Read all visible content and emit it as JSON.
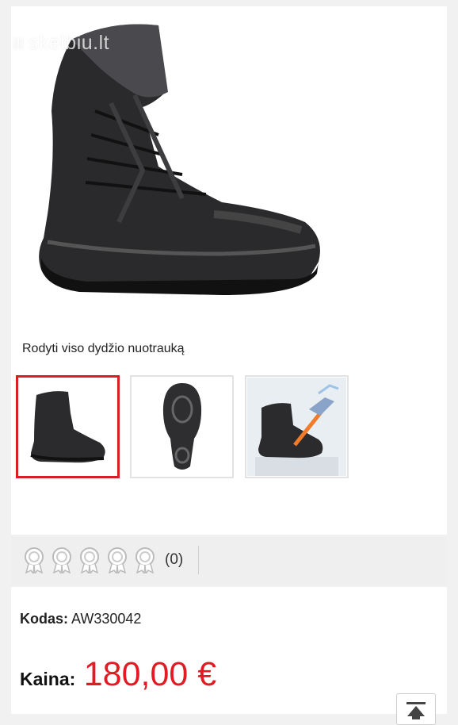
{
  "watermark": {
    "text": "skelbiu.lt"
  },
  "gallery": {
    "full_size_link": "Rodyti viso dydžio nuotrauką",
    "thumbnails": [
      {
        "label": "boot side view",
        "active": true
      },
      {
        "label": "boot sole view",
        "active": false
      },
      {
        "label": "boot membrane view",
        "active": false
      }
    ]
  },
  "rating": {
    "medal_count": 5,
    "count_text": "(0)"
  },
  "product": {
    "code_label": "Kodas:",
    "code_value": "AW330042",
    "price_label": "Kaina:",
    "price_value": "180,00 €"
  },
  "colors": {
    "accent": "#d91d24",
    "price": "#e21b23"
  }
}
